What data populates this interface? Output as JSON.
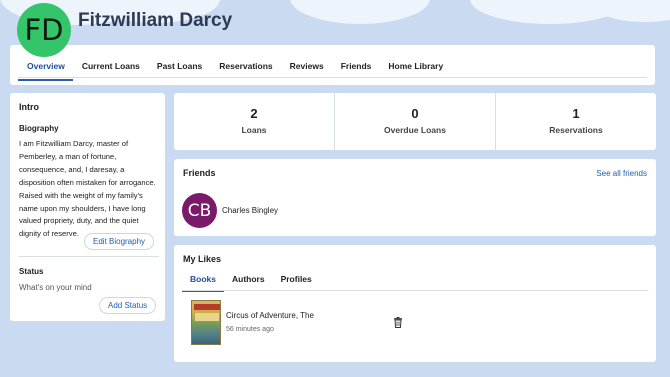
{
  "profile": {
    "initials": "FD",
    "name": "Fitzwilliam Darcy",
    "avatar_color": "#34c46a"
  },
  "nav": {
    "tabs": [
      "Overview",
      "Current Loans",
      "Past Loans",
      "Reservations",
      "Reviews",
      "Friends",
      "Home Library"
    ],
    "active": "Overview"
  },
  "intro": {
    "title": "Intro",
    "biography_heading": "Biography",
    "biography_text": "I am Fitzwilliam Darcy, master of Pemberley, a man of fortune, consequence, and, I daresay, a disposition often mistaken for arrogance. Raised with the weight of my family's name upon my shoulders, I have long valued propriety, duty, and the quiet dignity of reserve.",
    "edit_biography_label": "Edit Biography",
    "status_heading": "Status",
    "status_placeholder": "What's on your mind",
    "add_status_label": "Add Status"
  },
  "stats": [
    {
      "value": "2",
      "label": "Loans"
    },
    {
      "value": "0",
      "label": "Overdue Loans"
    },
    {
      "value": "1",
      "label": "Reservations"
    }
  ],
  "friends": {
    "title": "Friends",
    "see_all_label": "See all friends",
    "items": [
      {
        "initials": "CB",
        "name": "Charles Bingley",
        "avatar_color": "#7b1a68"
      }
    ]
  },
  "likes": {
    "title": "My Likes",
    "tabs": [
      "Books",
      "Authors",
      "Profiles"
    ],
    "active": "Books",
    "items": [
      {
        "title": "Circus of Adventure, The",
        "time": "56 minutes ago"
      }
    ]
  },
  "colors": {
    "accent": "#1e5fb4",
    "background": "#c9daf1"
  }
}
